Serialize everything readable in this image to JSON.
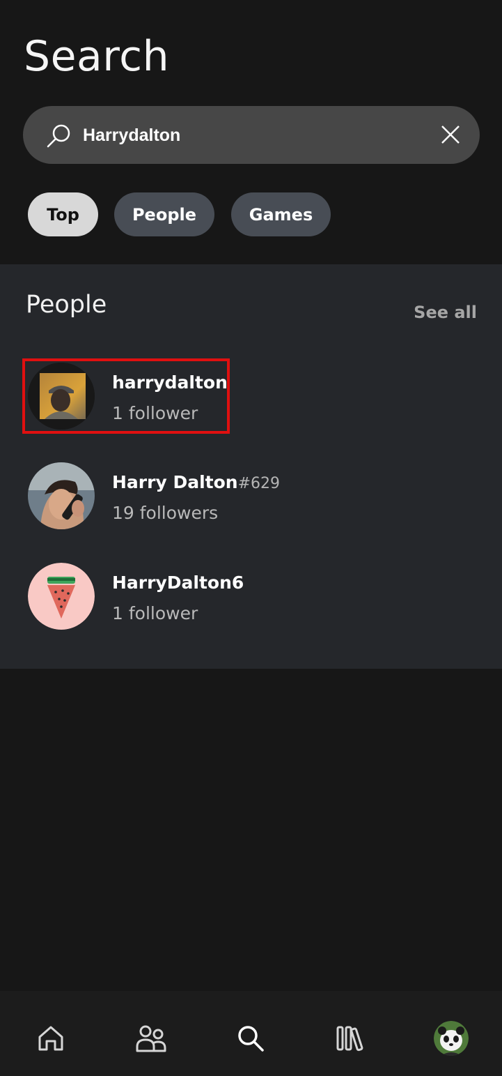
{
  "page": {
    "title": "Search"
  },
  "search": {
    "query": "Harrydalton",
    "placeholder": ""
  },
  "filters": [
    {
      "label": "Top",
      "active": true
    },
    {
      "label": "People",
      "active": false
    },
    {
      "label": "Games",
      "active": false
    }
  ],
  "people_section": {
    "title": "People",
    "see_all_label": "See all",
    "results": [
      {
        "name": "harrydalton",
        "tag": "",
        "followers": "1 follower",
        "avatar": "player-photo-avatar",
        "highlighted": true
      },
      {
        "name": "Harry Dalton",
        "tag": "#629",
        "followers": "19 followers",
        "avatar": "man-on-phone-avatar",
        "highlighted": false
      },
      {
        "name": "HarryDalton6",
        "tag": "",
        "followers": "1 follower",
        "avatar": "watermelon-avatar",
        "highlighted": false
      }
    ]
  },
  "bottom_nav": {
    "items": [
      "home-icon",
      "social-icon",
      "search-icon",
      "library-icon",
      "profile-avatar"
    ],
    "active": "search-icon"
  },
  "colors": {
    "background": "#171717",
    "panel": "#25272b",
    "chip_active": "#d8d8d8",
    "chip": "#484d55",
    "highlight": "#e01010"
  }
}
